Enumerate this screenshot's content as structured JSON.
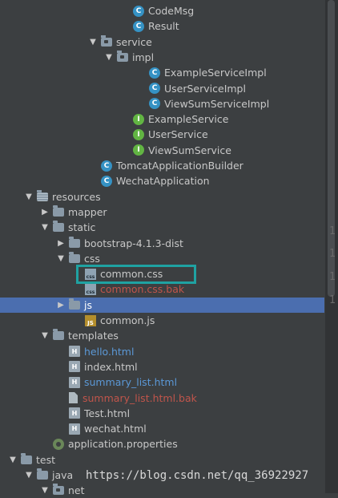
{
  "tree": [
    {
      "label": "CodeMsg",
      "icon": "class-icon",
      "depth": 7,
      "arrow": "",
      "color": "default"
    },
    {
      "label": "Result",
      "icon": "class-icon",
      "depth": 7,
      "arrow": "",
      "color": "default"
    },
    {
      "label": "service",
      "icon": "package-icon",
      "depth": 5,
      "arrow": "down",
      "color": "default"
    },
    {
      "label": "impl",
      "icon": "package-icon",
      "depth": 6,
      "arrow": "down",
      "color": "default"
    },
    {
      "label": "ExampleServiceImpl",
      "icon": "class-icon",
      "depth": 8,
      "arrow": "",
      "color": "default"
    },
    {
      "label": "UserServiceImpl",
      "icon": "class-icon",
      "depth": 8,
      "arrow": "",
      "color": "default"
    },
    {
      "label": "ViewSumServiceImpl",
      "icon": "class-icon",
      "depth": 8,
      "arrow": "",
      "color": "default"
    },
    {
      "label": "ExampleService",
      "icon": "interface-icon",
      "depth": 7,
      "arrow": "",
      "color": "default"
    },
    {
      "label": "UserService",
      "icon": "interface-icon",
      "depth": 7,
      "arrow": "",
      "color": "default"
    },
    {
      "label": "ViewSumService",
      "icon": "interface-icon",
      "depth": 7,
      "arrow": "",
      "color": "default"
    },
    {
      "label": "TomcatApplicationBuilder",
      "icon": "class-icon",
      "depth": 5,
      "arrow": "",
      "color": "default"
    },
    {
      "label": "WechatApplication",
      "icon": "class-icon",
      "depth": 5,
      "arrow": "",
      "color": "default"
    },
    {
      "label": "resources",
      "icon": "resources-folder-icon",
      "depth": 1,
      "arrow": "down",
      "color": "default"
    },
    {
      "label": "mapper",
      "icon": "folder-icon",
      "depth": 2,
      "arrow": "right",
      "color": "default"
    },
    {
      "label": "static",
      "icon": "folder-icon",
      "depth": 2,
      "arrow": "down",
      "color": "default"
    },
    {
      "label": "bootstrap-4.1.3-dist",
      "icon": "folder-icon",
      "depth": 3,
      "arrow": "right",
      "color": "default"
    },
    {
      "label": "css",
      "icon": "folder-icon",
      "depth": 3,
      "arrow": "down",
      "color": "default"
    },
    {
      "label": "common.css",
      "icon": "css-file-icon",
      "depth": 4,
      "arrow": "",
      "color": "default"
    },
    {
      "label": "common.css.bak",
      "icon": "css-file-icon",
      "depth": 4,
      "arrow": "",
      "color": "red"
    },
    {
      "label": "js",
      "icon": "folder-icon",
      "depth": 3,
      "arrow": "right",
      "color": "default",
      "selected": true
    },
    {
      "label": "common.js",
      "icon": "js-file-icon",
      "depth": 4,
      "arrow": "",
      "color": "default"
    },
    {
      "label": "templates",
      "icon": "folder-icon",
      "depth": 2,
      "arrow": "down",
      "color": "default"
    },
    {
      "label": "hello.html",
      "icon": "html-file-icon",
      "depth": 3,
      "arrow": "",
      "color": "blue"
    },
    {
      "label": "index.html",
      "icon": "html-file-icon",
      "depth": 3,
      "arrow": "",
      "color": "default"
    },
    {
      "label": "summary_list.html",
      "icon": "html-file-icon",
      "depth": 3,
      "arrow": "",
      "color": "blue"
    },
    {
      "label": "summary_list.html.bak",
      "icon": "text-file-icon",
      "depth": 3,
      "arrow": "",
      "color": "red"
    },
    {
      "label": "Test.html",
      "icon": "html-file-icon",
      "depth": 3,
      "arrow": "",
      "color": "default"
    },
    {
      "label": "wechat.html",
      "icon": "html-file-icon",
      "depth": 3,
      "arrow": "",
      "color": "default"
    },
    {
      "label": "application.properties",
      "icon": "properties-icon",
      "depth": 2,
      "arrow": "",
      "color": "default"
    },
    {
      "label": "test",
      "icon": "folder-icon",
      "depth": 0,
      "arrow": "down",
      "color": "default"
    },
    {
      "label": "java",
      "icon": "folder-icon",
      "depth": 1,
      "arrow": "down",
      "color": "default"
    },
    {
      "label": "net",
      "icon": "package-icon",
      "depth": 2,
      "arrow": "down",
      "color": "default"
    }
  ],
  "gutter": [
    "1",
    "1",
    "1",
    "1"
  ],
  "watermark": "https://blog.csdn.net/qq_36922927",
  "colors": {
    "background": "#3c3f41",
    "selection": "#4b6eaf",
    "highlight_box": "#1fa2a2",
    "vcs_blue": "#5b98d6",
    "vcs_red": "#c0554b"
  }
}
